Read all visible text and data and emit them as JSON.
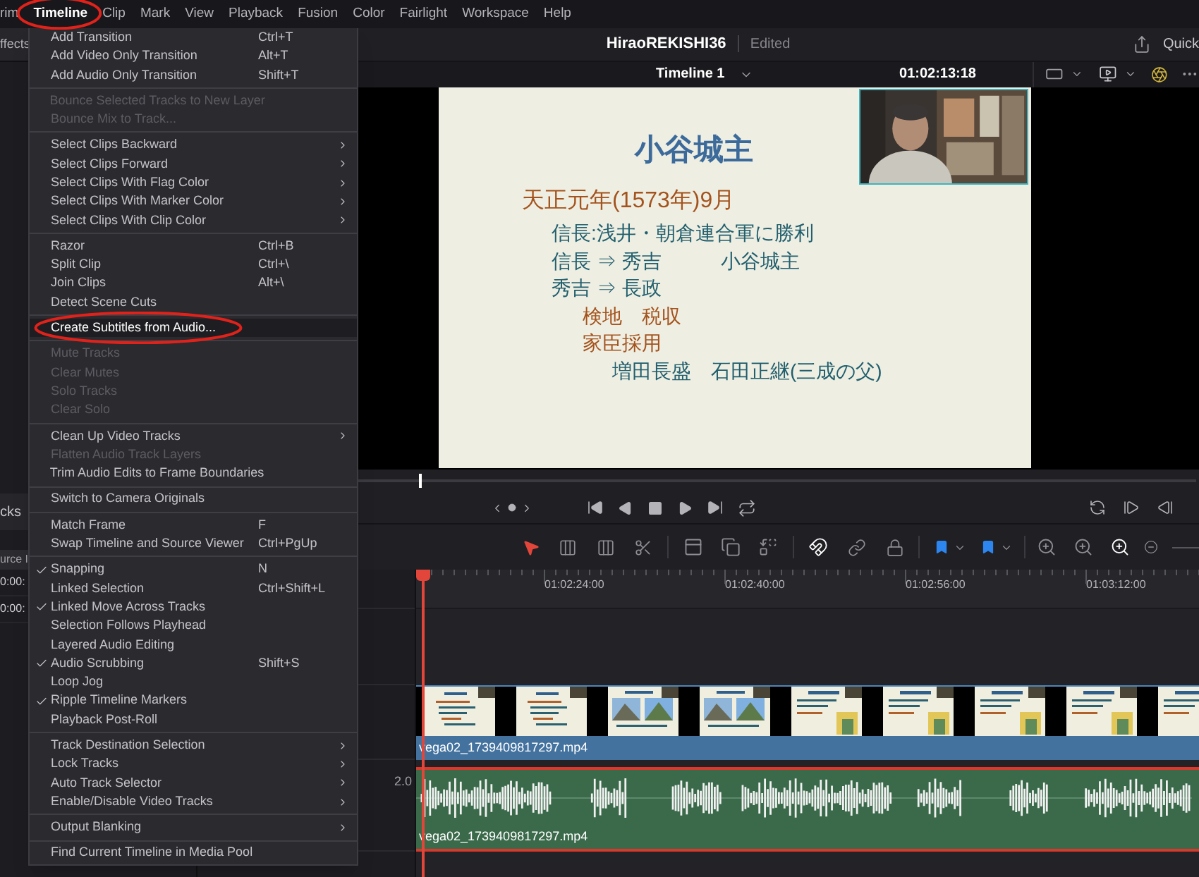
{
  "menubar": [
    {
      "label": "rim",
      "selected": false,
      "circled": false
    },
    {
      "label": "Timeline",
      "selected": true,
      "circled": true
    },
    {
      "label": "Clip",
      "selected": false,
      "circled": false
    },
    {
      "label": "Mark",
      "selected": false,
      "circled": false
    },
    {
      "label": "View",
      "selected": false,
      "circled": false
    },
    {
      "label": "Playback",
      "selected": false,
      "circled": false
    },
    {
      "label": "Fusion",
      "selected": false,
      "circled": false
    },
    {
      "label": "Color",
      "selected": false,
      "circled": false
    },
    {
      "label": "Fairlight",
      "selected": false,
      "circled": false
    },
    {
      "label": "Workspace",
      "selected": false,
      "circled": false
    },
    {
      "label": "Help",
      "selected": false,
      "circled": false
    }
  ],
  "left_panel": {
    "tab": "ffects",
    "section": "cks",
    "column": "urce I",
    "rows": [
      "0:00:",
      "0:00:"
    ]
  },
  "project": {
    "title": "HiraoREKISHI36",
    "status": "Edited",
    "quick_export": "Quick"
  },
  "viewer": {
    "timeline_name": "Timeline 1",
    "timecode": "01:02:13:18",
    "scrubber": {
      "level": 0.22
    },
    "slide": {
      "title": "小谷城主",
      "lines": [
        {
          "kind": "date",
          "text": "天正元年(1573年)9月"
        },
        {
          "kind": "point",
          "text": "信長:浅井・朝倉連合軍に勝利"
        },
        {
          "kind": "point",
          "text": "信長 ⇒ 秀吉　　　小谷城主"
        },
        {
          "kind": "point",
          "text": "秀吉 ⇒ 長政"
        },
        {
          "kind": "note",
          "text": "検地　税収"
        },
        {
          "kind": "note",
          "text": "家臣採用"
        },
        {
          "kind": "detail",
          "text": "増田長盛　石田正継(三成の父)"
        }
      ]
    }
  },
  "timeline": {
    "ruler": [
      "01:02:24:00",
      "01:02:40:00",
      "01:02:56:00",
      "01:03:12:00"
    ],
    "video_clip": {
      "name": "vega02_1739409817297.mp4"
    },
    "audio_track": {
      "format": "2.0"
    },
    "audio_clip": {
      "name": "vega02_1739409817297.mp4",
      "selected": true
    }
  },
  "menu": [
    {
      "kind": "item",
      "label": "Add Transition",
      "shortcut": "Ctrl+T",
      "submenu": false,
      "checked": false,
      "disabled": false,
      "highlighted": false,
      "circled": false
    },
    {
      "kind": "item",
      "label": "Add Video Only Transition",
      "shortcut": "Alt+T",
      "submenu": false,
      "checked": false,
      "disabled": false,
      "highlighted": false,
      "circled": false
    },
    {
      "kind": "item",
      "label": "Add Audio Only Transition",
      "shortcut": "Shift+T",
      "submenu": false,
      "checked": false,
      "disabled": false,
      "highlighted": false,
      "circled": false
    },
    {
      "kind": "separator"
    },
    {
      "kind": "item",
      "label": "Bounce Selected Tracks to New Layer",
      "submenu": false,
      "checked": false,
      "disabled": true,
      "highlighted": false,
      "circled": false
    },
    {
      "kind": "item",
      "label": "Bounce Mix to Track...",
      "submenu": false,
      "checked": false,
      "disabled": true,
      "highlighted": false,
      "circled": false
    },
    {
      "kind": "separator"
    },
    {
      "kind": "item",
      "label": "Select Clips Backward",
      "submenu": true,
      "checked": false,
      "disabled": false,
      "highlighted": false,
      "circled": false
    },
    {
      "kind": "item",
      "label": "Select Clips Forward",
      "submenu": true,
      "checked": false,
      "disabled": false,
      "highlighted": false,
      "circled": false
    },
    {
      "kind": "item",
      "label": "Select Clips With Flag Color",
      "submenu": true,
      "checked": false,
      "disabled": false,
      "highlighted": false,
      "circled": false
    },
    {
      "kind": "item",
      "label": "Select Clips With Marker Color",
      "submenu": true,
      "checked": false,
      "disabled": false,
      "highlighted": false,
      "circled": false
    },
    {
      "kind": "item",
      "label": "Select Clips With Clip Color",
      "submenu": true,
      "checked": false,
      "disabled": false,
      "highlighted": false,
      "circled": false
    },
    {
      "kind": "separator"
    },
    {
      "kind": "item",
      "label": "Razor",
      "shortcut": "Ctrl+B",
      "submenu": false,
      "checked": false,
      "disabled": false,
      "highlighted": false,
      "circled": false
    },
    {
      "kind": "item",
      "label": "Split Clip",
      "shortcut": "Ctrl+\\",
      "submenu": false,
      "checked": false,
      "disabled": false,
      "highlighted": false,
      "circled": false
    },
    {
      "kind": "item",
      "label": "Join Clips",
      "shortcut": "Alt+\\",
      "submenu": false,
      "checked": false,
      "disabled": false,
      "highlighted": false,
      "circled": false
    },
    {
      "kind": "item",
      "label": "Detect Scene Cuts",
      "submenu": false,
      "checked": false,
      "disabled": false,
      "highlighted": false,
      "circled": false
    },
    {
      "kind": "separator"
    },
    {
      "kind": "item",
      "label": "Create Subtitles from Audio...",
      "submenu": false,
      "checked": false,
      "disabled": false,
      "highlighted": true,
      "circled": true
    },
    {
      "kind": "separator"
    },
    {
      "kind": "item",
      "label": "Mute Tracks",
      "submenu": false,
      "checked": false,
      "disabled": true,
      "highlighted": false,
      "circled": false
    },
    {
      "kind": "item",
      "label": "Clear Mutes",
      "submenu": false,
      "checked": false,
      "disabled": true,
      "highlighted": false,
      "circled": false
    },
    {
      "kind": "item",
      "label": "Solo Tracks",
      "submenu": false,
      "checked": false,
      "disabled": true,
      "highlighted": false,
      "circled": false
    },
    {
      "kind": "item",
      "label": "Clear Solo",
      "submenu": false,
      "checked": false,
      "disabled": true,
      "highlighted": false,
      "circled": false
    },
    {
      "kind": "separator"
    },
    {
      "kind": "item",
      "label": "Clean Up Video Tracks",
      "submenu": true,
      "checked": false,
      "disabled": false,
      "highlighted": false,
      "circled": false
    },
    {
      "kind": "item",
      "label": "Flatten Audio Track Layers",
      "submenu": false,
      "checked": false,
      "disabled": true,
      "highlighted": false,
      "circled": false
    },
    {
      "kind": "item",
      "label": "Trim Audio Edits to Frame Boundaries",
      "submenu": false,
      "checked": false,
      "disabled": false,
      "highlighted": false,
      "circled": false
    },
    {
      "kind": "separator"
    },
    {
      "kind": "item",
      "label": "Switch to Camera Originals",
      "submenu": false,
      "checked": false,
      "disabled": false,
      "highlighted": false,
      "circled": false
    },
    {
      "kind": "separator"
    },
    {
      "kind": "item",
      "label": "Match Frame",
      "shortcut": "F",
      "submenu": false,
      "checked": false,
      "disabled": false,
      "highlighted": false,
      "circled": false
    },
    {
      "kind": "item",
      "label": "Swap Timeline and Source Viewer",
      "shortcut": "Ctrl+PgUp",
      "submenu": false,
      "checked": false,
      "disabled": false,
      "highlighted": false,
      "circled": false
    },
    {
      "kind": "separator"
    },
    {
      "kind": "item",
      "label": "Snapping",
      "shortcut": "N",
      "submenu": false,
      "checked": true,
      "disabled": false,
      "highlighted": false,
      "circled": false
    },
    {
      "kind": "item",
      "label": "Linked Selection",
      "shortcut": "Ctrl+Shift+L",
      "submenu": false,
      "checked": false,
      "disabled": false,
      "highlighted": false,
      "circled": false
    },
    {
      "kind": "item",
      "label": "Linked Move Across Tracks",
      "submenu": false,
      "checked": true,
      "disabled": false,
      "highlighted": false,
      "circled": false
    },
    {
      "kind": "item",
      "label": "Selection Follows Playhead",
      "submenu": false,
      "checked": false,
      "disabled": false,
      "highlighted": false,
      "circled": false
    },
    {
      "kind": "item",
      "label": "Layered Audio Editing",
      "submenu": false,
      "checked": false,
      "disabled": false,
      "highlighted": false,
      "circled": false
    },
    {
      "kind": "item",
      "label": "Audio Scrubbing",
      "shortcut": "Shift+S",
      "submenu": false,
      "checked": true,
      "disabled": false,
      "highlighted": false,
      "circled": false
    },
    {
      "kind": "item",
      "label": "Loop Jog",
      "submenu": false,
      "checked": false,
      "disabled": false,
      "highlighted": false,
      "circled": false
    },
    {
      "kind": "item",
      "label": "Ripple Timeline Markers",
      "submenu": false,
      "checked": true,
      "disabled": false,
      "highlighted": false,
      "circled": false
    },
    {
      "kind": "item",
      "label": "Playback Post-Roll",
      "submenu": false,
      "checked": false,
      "disabled": false,
      "highlighted": false,
      "circled": false
    },
    {
      "kind": "separator"
    },
    {
      "kind": "item",
      "label": "Track Destination Selection",
      "submenu": true,
      "checked": false,
      "disabled": false,
      "highlighted": false,
      "circled": false
    },
    {
      "kind": "item",
      "label": "Lock Tracks",
      "submenu": true,
      "checked": false,
      "disabled": false,
      "highlighted": false,
      "circled": false
    },
    {
      "kind": "item",
      "label": "Auto Track Selector",
      "submenu": true,
      "checked": false,
      "disabled": false,
      "highlighted": false,
      "circled": false
    },
    {
      "kind": "item",
      "label": "Enable/Disable Video Tracks",
      "submenu": true,
      "checked": false,
      "disabled": false,
      "highlighted": false,
      "circled": false
    },
    {
      "kind": "separator"
    },
    {
      "kind": "item",
      "label": "Output Blanking",
      "submenu": true,
      "checked": false,
      "disabled": false,
      "highlighted": false,
      "circled": false
    },
    {
      "kind": "separator"
    },
    {
      "kind": "item",
      "label": "Find Current Timeline in Media Pool",
      "submenu": false,
      "checked": false,
      "disabled": false,
      "highlighted": false,
      "circled": false
    }
  ]
}
